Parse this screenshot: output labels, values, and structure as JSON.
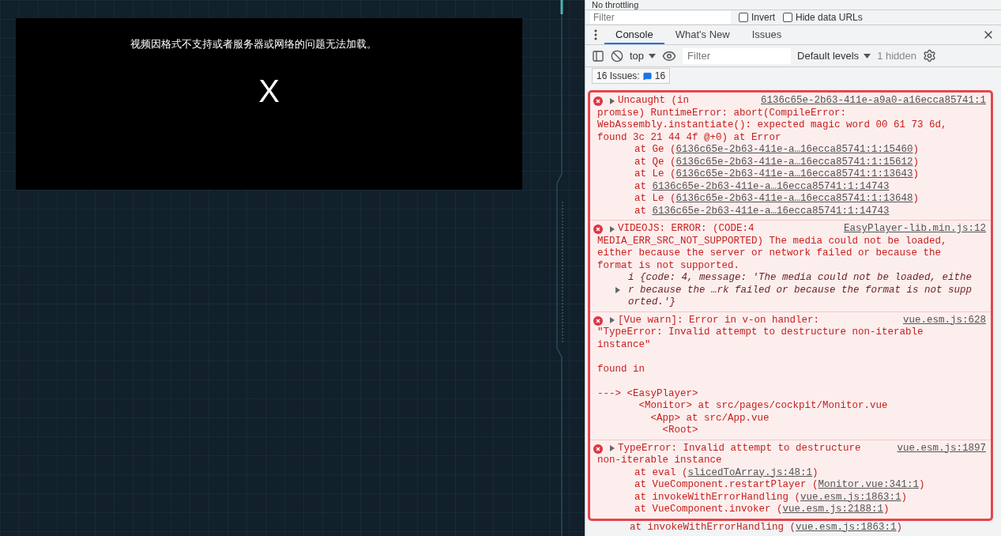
{
  "network_bar": {
    "throttling": "No throttling"
  },
  "filter_bar": {
    "placeholder": "Filter",
    "options": [
      {
        "label": "Invert",
        "checked": false
      },
      {
        "label": "Hide data URLs",
        "checked": false
      }
    ]
  },
  "video": {
    "message": "视频因格式不支持或者服务器或网络的问题无法加载。",
    "close": "X"
  },
  "drawer": {
    "tabs": [
      {
        "label": "Console",
        "selected": true
      },
      {
        "label": "What's New",
        "selected": false
      },
      {
        "label": "Issues",
        "selected": false
      }
    ]
  },
  "toolbar": {
    "context": "top",
    "filter_placeholder": "Filter",
    "levels": "Default levels",
    "hidden": "1 hidden"
  },
  "issues": {
    "label": "16 Issues:",
    "count": "16"
  },
  "messages": [
    {
      "kind": "error",
      "expanded": false,
      "source": "6136c65e-2b63-411e-a9a0-a16ecca85741:1",
      "head": [
        "Uncaught (in",
        "promise) RuntimeError: abort(CompileError:",
        "WebAssembly.instantiate(): expected magic word 00 61 73 6d,",
        "found 3c 21 44 4f @+0) at Error"
      ],
      "frames": [
        {
          "before": "at Ge (",
          "link": "6136c65e-2b63-411e-a…16ecca85741:1:15460",
          "after": ")"
        },
        {
          "before": "at Qe (",
          "link": "6136c65e-2b63-411e-a…16ecca85741:1:15612",
          "after": ")"
        },
        {
          "before": "at Le (",
          "link": "6136c65e-2b63-411e-a…16ecca85741:1:13643",
          "after": ")"
        },
        {
          "before": "at",
          "link": "6136c65e-2b63-411e-a…16ecca85741:1:14743"
        },
        {
          "before": "at Le (",
          "link": "6136c65e-2b63-411e-a…16ecca85741:1:13648",
          "after": ")"
        },
        {
          "before": "at",
          "link": "6136c65e-2b63-411e-a…16ecca85741:1:14743"
        }
      ]
    },
    {
      "kind": "error",
      "expanded": false,
      "source": "EasyPlayer-lib.min.js:12",
      "head": [
        "VIDEOJS: ERROR: (CODE:4",
        "MEDIA_ERR_SRC_NOT_SUPPORTED) The media could not be loaded,",
        "either because the server or network failed or because the",
        "format is not supported."
      ],
      "object": {
        "expanded": false,
        "lines": [
          "i {code: 4, message: 'The media could not be loaded, eithe",
          "r because the …rk failed or because the format is not supp",
          "orted.'}"
        ]
      }
    },
    {
      "kind": "error",
      "expanded": false,
      "source": "vue.esm.js:628",
      "head": [
        "[Vue warn]: Error in v-on handler:",
        "\"TypeError: Invalid attempt to destructure non-iterable",
        "instance\""
      ],
      "paragraphs": [
        [
          "found in"
        ],
        [
          "---> <EasyPlayer>",
          "       <Monitor> at src/pages/cockpit/Monitor.vue",
          "         <App> at src/App.vue",
          "           <Root>"
        ]
      ]
    },
    {
      "kind": "error",
      "expanded": false,
      "source": "vue.esm.js:1897",
      "head": [
        "TypeError: Invalid attempt to destructure",
        "non-iterable instance"
      ],
      "frames": [
        {
          "before": "at eval (",
          "link": "slicedToArray.js:48:1",
          "after": ")"
        },
        {
          "before": "at VueComponent.restartPlayer (",
          "link": "Monitor.vue:341:1",
          "after": ")"
        },
        {
          "before": "at invokeWithErrorHandling (",
          "link": "vue.esm.js:1863:1",
          "after": ")"
        },
        {
          "before": "at VueComponent.invoker (",
          "link": "vue.esm.js:2188:1",
          "after": ")"
        }
      ]
    }
  ],
  "trailing_frame": {
    "before": "at invokeWithErrorHandling (",
    "link": "vue.esm.js:1863:1",
    "after": ")"
  }
}
